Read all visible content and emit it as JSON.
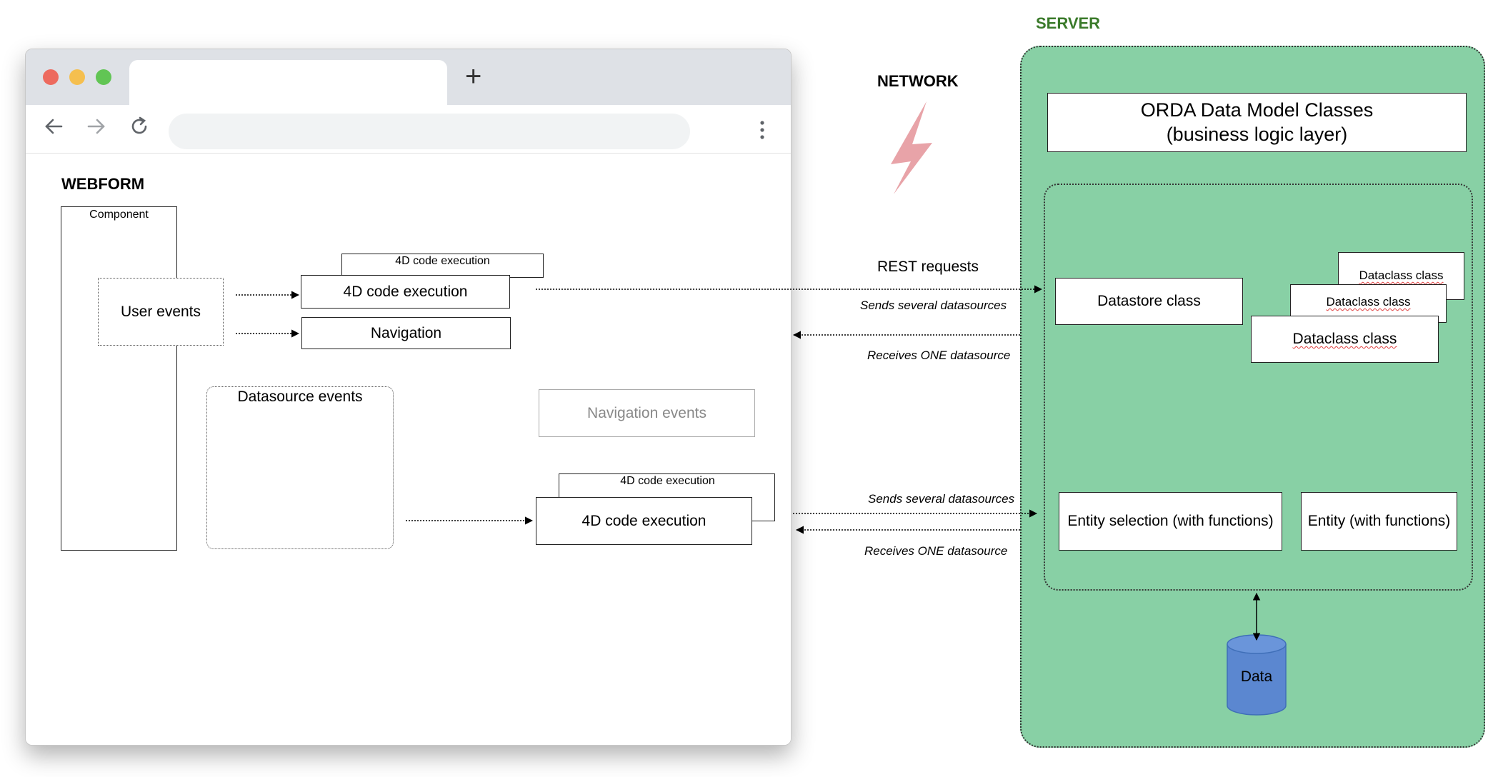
{
  "browser": {
    "new_tab_glyph": "+",
    "icons": [
      "back-arrow-icon",
      "forward-arrow-icon",
      "reload-icon",
      "kebab-menu-icon"
    ],
    "traffic_lights": {
      "red": "#ed6a5e",
      "yellow": "#f5bf4f",
      "green": "#61c554"
    }
  },
  "webform": {
    "title": "WEBFORM",
    "component_label": "Component",
    "user_events": "User events",
    "code_exec_small_top": "4D code execution",
    "code_exec_top": "4D code execution",
    "navigation": "Navigation",
    "datasource_events": "Datasource events",
    "navigation_events": "Navigation events",
    "code_exec_small_bottom": "4D code execution",
    "code_exec_bottom": "4D code execution"
  },
  "network": {
    "title": "NETWORK",
    "rest_requests": "REST requests",
    "sends_top": "Sends several datasources",
    "receives_top": "Receives ONE datasource",
    "sends_bottom": "Sends several datasources",
    "receives_bottom": "Receives ONE datasource",
    "bolt_color": "#e8a3a8"
  },
  "server": {
    "title": "SERVER",
    "title_color": "#3a7a2a",
    "background": "#88d0a5",
    "orda_line1": "ORDA Data Model Classes",
    "orda_line2": "(business logic layer)",
    "datastore_class": "Datastore class",
    "dataclass_back": "Dataclass class",
    "dataclass_mid": "Dataclass class",
    "dataclass_front": "Dataclass class",
    "entity_selection": "Entity selection (with functions)",
    "entity": "Entity (with functions)",
    "data": "Data",
    "db_color": "#5b87d0"
  }
}
